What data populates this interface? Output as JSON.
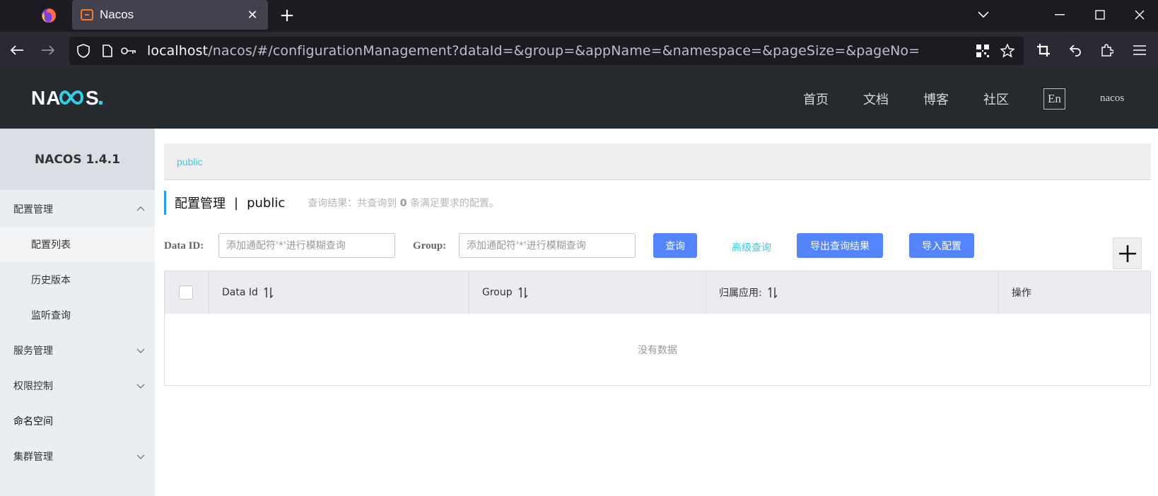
{
  "browser": {
    "tab_title": "Nacos",
    "url_host": "localhost",
    "url_path": "/nacos/#/configurationManagement?dataId=&group=&appName=&namespace=&pageSize=&pageNo="
  },
  "header": {
    "nav": [
      "首页",
      "文档",
      "博客",
      "社区"
    ],
    "lang": "En",
    "user": "nacos"
  },
  "sidebar": {
    "title": "NACOS 1.4.1",
    "items": [
      {
        "label": "配置管理",
        "icon": "chevron-up-icon"
      },
      {
        "label": "配置列表"
      },
      {
        "label": "历史版本"
      },
      {
        "label": "监听查询"
      },
      {
        "label": "服务管理",
        "icon": "chevron-down-icon"
      },
      {
        "label": "权限控制",
        "icon": "chevron-down-icon"
      },
      {
        "label": "命名空间"
      },
      {
        "label": "集群管理",
        "icon": "chevron-down-icon"
      }
    ]
  },
  "main": {
    "namespace": "public",
    "title": "配置管理",
    "separator": "|",
    "title_ns": "public",
    "result_prefix": "查询结果：共查询到",
    "result_count": "0",
    "result_suffix": "条满足要求的配置。",
    "filters": {
      "dataid_label": "Data ID:",
      "dataid_placeholder": "添加通配符'*'进行模糊查询",
      "group_label": "Group:",
      "group_placeholder": "添加通配符'*'进行模糊查询"
    },
    "buttons": {
      "query": "查询",
      "advanced": "高级查询",
      "export": "导出查询结果",
      "import": "导入配置"
    },
    "table": {
      "columns": [
        "Data Id",
        "Group",
        "归属应用:",
        "操作"
      ],
      "empty": "没有数据"
    }
  },
  "colors": {
    "primary": "#5584ff",
    "link": "#33cde5",
    "header_bg": "#252a2f",
    "accent_bar": "#209bfa"
  }
}
